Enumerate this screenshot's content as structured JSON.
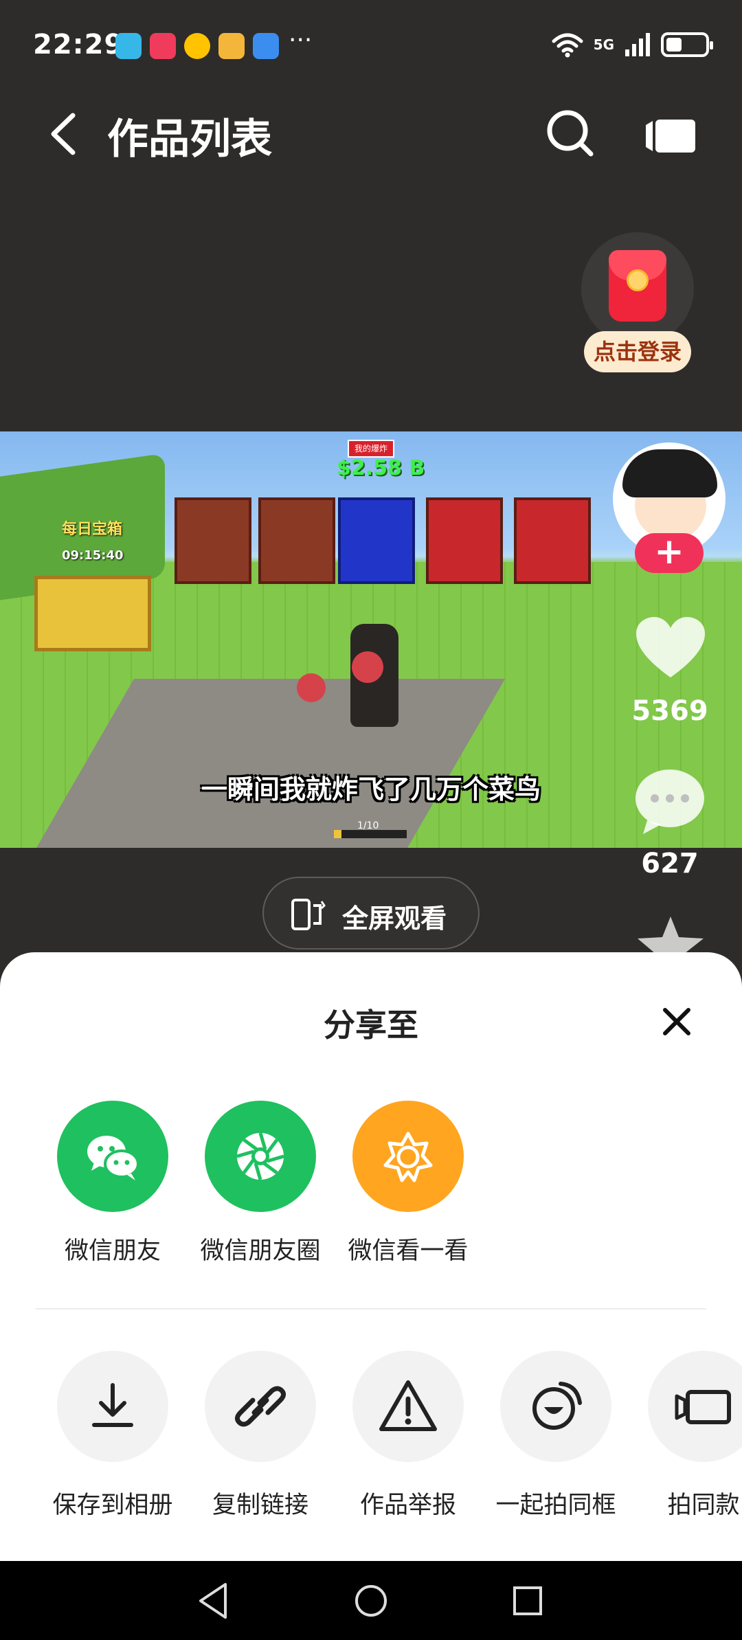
{
  "status_bar": {
    "time": "22:29",
    "more": "···",
    "network": "5G",
    "app_icons": [
      {
        "name": "reader-app-icon",
        "color": "#36b7e8"
      },
      {
        "name": "video-app-icon",
        "color": "#f03b5c"
      },
      {
        "name": "meituan-app-icon",
        "color": "#ffc300"
      },
      {
        "name": "game-app-icon",
        "color": "#f4b63a"
      },
      {
        "name": "shield-app-icon",
        "color": "#3b8ef0"
      }
    ]
  },
  "header": {
    "title": "作品列表",
    "back_icon": "chevron-left-icon",
    "search_icon": "search-icon",
    "camera_icon": "video-camera-icon"
  },
  "red_packet": {
    "login_label": "点击登录"
  },
  "video": {
    "subtitle": "一瞬间我就炸飞了几万个菜鸟",
    "money": "$2.58 B",
    "top_badge": "我的爆炸",
    "chest_label": "每日宝箱",
    "chest_timer": "09:15:40",
    "progress_label": "1/10",
    "progress": 0.1
  },
  "side_rail": {
    "likes": "5369",
    "comments": "627"
  },
  "fullscreen": {
    "label": "全屏观看"
  },
  "share_sheet": {
    "title": "分享至",
    "share_targets": [
      {
        "label": "微信朋友",
        "icon": "wechat-icon",
        "color": "#1fc05f"
      },
      {
        "label": "微信朋友圈",
        "icon": "moments-icon",
        "color": "#1fc05f"
      },
      {
        "label": "微信看一看",
        "icon": "wechat-look-icon",
        "color": "#ffa51f"
      }
    ],
    "actions": [
      {
        "label": "保存到相册",
        "icon": "download-icon"
      },
      {
        "label": "复制链接",
        "icon": "link-icon"
      },
      {
        "label": "作品举报",
        "icon": "warning-icon"
      },
      {
        "label": "一起拍同框",
        "icon": "duet-icon"
      },
      {
        "label": "拍同款",
        "icon": "video-camera-icon"
      }
    ]
  },
  "colors": {
    "background": "#2e2c2a",
    "accent_pink": "#f0325a",
    "wechat_green": "#1fc05f",
    "look_orange": "#ffa51f"
  }
}
